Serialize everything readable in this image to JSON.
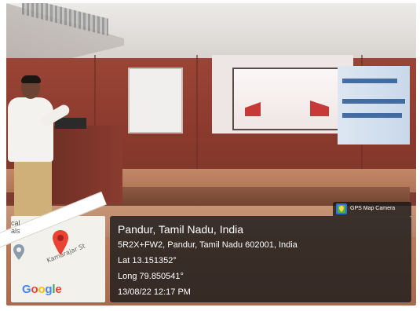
{
  "overlay": {
    "app_badge": "GPS Map Camera",
    "location_title": "Pandur, Tamil Nadu, India",
    "address": "5R2X+FW2, Pandur, Tamil Nadu 602001, India",
    "latitude": "Lat 13.151352°",
    "longitude": "Long 79.850541°",
    "datetime": "13/08/22 12:17 PM"
  },
  "map": {
    "street_label": "Kamarajar St",
    "side_text": "cal\nals",
    "logo_letters": [
      "G",
      "o",
      "o",
      "g",
      "l",
      "e"
    ],
    "logo_colors": [
      "#4285F4",
      "#EA4335",
      "#FBBC05",
      "#4285F4",
      "#34A853",
      "#EA4335"
    ],
    "pin_color": "#EA4335"
  },
  "icons": {
    "location_pin": "map-pin-icon",
    "app_icon": "gps-map-camera-icon"
  }
}
